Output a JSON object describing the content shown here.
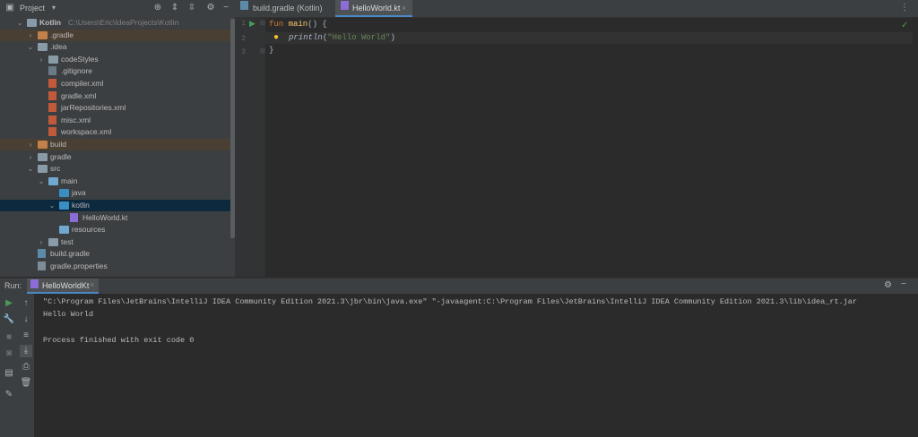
{
  "project_panel": {
    "title": "Project",
    "tree": [
      {
        "label": "Kotlin",
        "path": "C:\\Users\\Eric\\IdeaProjects\\Kotlin",
        "depth": 0,
        "expanded": true,
        "icon": "folder-icon"
      },
      {
        "label": ".gradle",
        "depth": 1,
        "expanded": false,
        "icon": "folder-orange-icon"
      },
      {
        "label": ".idea",
        "depth": 1,
        "expanded": true,
        "icon": "folder-icon"
      },
      {
        "label": "codeStyles",
        "depth": 2,
        "expanded": false,
        "icon": "folder-icon"
      },
      {
        "label": ".gitignore",
        "depth": 2,
        "icon": "gitignore-file-icon"
      },
      {
        "label": "compiler.xml",
        "depth": 2,
        "icon": "xml-file-icon"
      },
      {
        "label": "gradle.xml",
        "depth": 2,
        "icon": "xml-file-icon"
      },
      {
        "label": "jarRepositories.xml",
        "depth": 2,
        "icon": "xml-file-icon"
      },
      {
        "label": "misc.xml",
        "depth": 2,
        "icon": "xml-file-icon"
      },
      {
        "label": "workspace.xml",
        "depth": 2,
        "icon": "xml-file-icon"
      },
      {
        "label": "build",
        "depth": 1,
        "expanded": false,
        "icon": "folder-orange-icon"
      },
      {
        "label": "gradle",
        "depth": 1,
        "expanded": false,
        "icon": "folder-icon"
      },
      {
        "label": "src",
        "depth": 1,
        "expanded": true,
        "icon": "folder-icon"
      },
      {
        "label": "main",
        "depth": 2,
        "expanded": true,
        "icon": "module-folder-icon"
      },
      {
        "label": "java",
        "depth": 3,
        "icon": "source-folder-icon"
      },
      {
        "label": "kotlin",
        "depth": 3,
        "expanded": true,
        "icon": "source-folder-icon"
      },
      {
        "label": "HelloWorld.kt",
        "depth": 4,
        "icon": "kotlin-file-icon"
      },
      {
        "label": "resources",
        "depth": 3,
        "icon": "resources-folder-icon"
      },
      {
        "label": "test",
        "depth": 2,
        "expanded": false,
        "icon": "folder-icon"
      },
      {
        "label": "build.gradle",
        "depth": 1,
        "icon": "gradle-file-icon"
      },
      {
        "label": "gradle.properties",
        "depth": 1,
        "icon": "properties-file-icon"
      }
    ]
  },
  "editor": {
    "tabs": [
      {
        "label": "build.gradle (Kotlin)",
        "active": false,
        "icon": "gradle-file-icon"
      },
      {
        "label": "HelloWorld.kt",
        "active": true,
        "icon": "kotlin-file-icon"
      }
    ],
    "line_numbers": [
      "1",
      "2",
      "3"
    ],
    "code": {
      "line1_kw": "fun",
      "line1_fn": "main",
      "line1_rest": "() {",
      "line2_call": "println",
      "line2_open": "(",
      "line2_str": "\"Hello World\"",
      "line2_close": ")",
      "line3": "}"
    }
  },
  "run_panel": {
    "label": "Run:",
    "tab": "HelloWorldKt",
    "console": [
      "\"C:\\Program Files\\JetBrains\\IntelliJ IDEA Community Edition 2021.3\\jbr\\bin\\java.exe\" \"-javaagent:C:\\Program Files\\JetBrains\\IntelliJ IDEA Community Edition 2021.3\\lib\\idea_rt.jar",
      "Hello World",
      "",
      "Process finished with exit code 0"
    ]
  },
  "colors": {
    "accent": "#4a88c7",
    "keyword": "#cc7832",
    "function": "#ffc66d",
    "string": "#6a8759",
    "run_green": "#499c54"
  }
}
